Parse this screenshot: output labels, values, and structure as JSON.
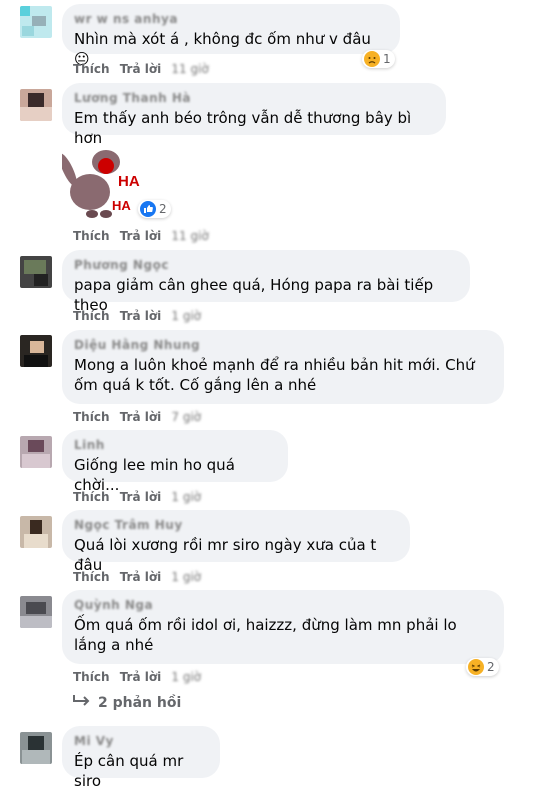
{
  "labels": {
    "like": "Thích",
    "reply": "Trả lời"
  },
  "comments": [
    {
      "name": "wr w ns anhya",
      "text": "Nhìn mà xót á , không đc ốm như v đâu 😐",
      "time": "11 giờ",
      "reaction_count": "1"
    },
    {
      "name": "Lương Thanh Hà",
      "text": "Em thấy anh béo trông vẫn dễ thương bây bì hơn",
      "time": "11 giờ",
      "reaction_count": "2",
      "sticker_text": "HA HA"
    },
    {
      "name": "Phương Ngọc",
      "text": "papa giảm cân ghee quá, Hóng papa ra bài tiếp theo",
      "time": "1 giờ"
    },
    {
      "name": "Diệu Hằng Nhung",
      "text": "Mong a luôn khoẻ mạnh để ra nhiều bản hit mới. Chứ ốm quá k tốt. Cố gắng lên a nhé",
      "time": "7 giờ"
    },
    {
      "name": "Linh",
      "text": "Giống lee min ho quá chời...",
      "time": "1 giờ"
    },
    {
      "name": "Ngọc Trâm Huy",
      "text": "Quá lòi xương rồi mr siro ngày xưa của t đâu",
      "time": "1 giờ"
    },
    {
      "name": "Quỳnh Nga",
      "text": "Ốm quá ốm rồi idol ơi, haizzz, đừng làm mn phải lo lắng a nhé",
      "time": "1 giờ",
      "reaction_count": "2",
      "replies": "2 phản hồi"
    },
    {
      "name": "Mi Vy",
      "text": "Ép cân quá mr siro"
    }
  ]
}
